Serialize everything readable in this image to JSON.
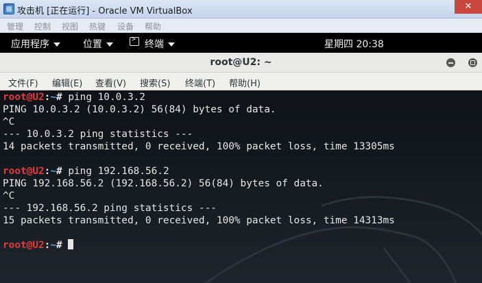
{
  "vbox": {
    "title": "攻击机 [正在运行] - Oracle VM VirtualBox",
    "menu": [
      "管理",
      "控制",
      "视图",
      "热键",
      "设备",
      "帮助"
    ]
  },
  "gnome": {
    "applications": "应用程序",
    "places": "位置",
    "terminal": "终端",
    "clock": "星期四 20:38"
  },
  "terminal": {
    "title": "root@U2: ~",
    "menu": [
      "文件(F)",
      "编辑(E)",
      "查看(V)",
      "搜索(S)",
      "终端(T)",
      "帮助(H)"
    ],
    "prompt": {
      "user": "root@U2",
      "sep": ":",
      "path": "~",
      "symbol": "# "
    },
    "lines": [
      {
        "type": "prompt",
        "cmd": "ping 10.0.3.2"
      },
      {
        "type": "out",
        "text": "PING 10.0.3.2 (10.0.3.2) 56(84) bytes of data."
      },
      {
        "type": "out",
        "text": "^C"
      },
      {
        "type": "out",
        "text": "--- 10.0.3.2 ping statistics ---"
      },
      {
        "type": "out",
        "text": "14 packets transmitted, 0 received, 100% packet loss, time 13305ms"
      },
      {
        "type": "out",
        "text": ""
      },
      {
        "type": "prompt",
        "cmd": "ping 192.168.56.2"
      },
      {
        "type": "out",
        "text": "PING 192.168.56.2 (192.168.56.2) 56(84) bytes of data."
      },
      {
        "type": "out",
        "text": "^C"
      },
      {
        "type": "out",
        "text": "--- 192.168.56.2 ping statistics ---"
      },
      {
        "type": "out",
        "text": "15 packets transmitted, 0 received, 100% packet loss, time 14313ms"
      },
      {
        "type": "out",
        "text": ""
      },
      {
        "type": "prompt",
        "cmd": "",
        "cursor": true
      }
    ]
  },
  "colors": {
    "prompt_user": "#e53a3a",
    "prompt_path": "#5fa4e8",
    "terminal_bg": "#151a20"
  }
}
